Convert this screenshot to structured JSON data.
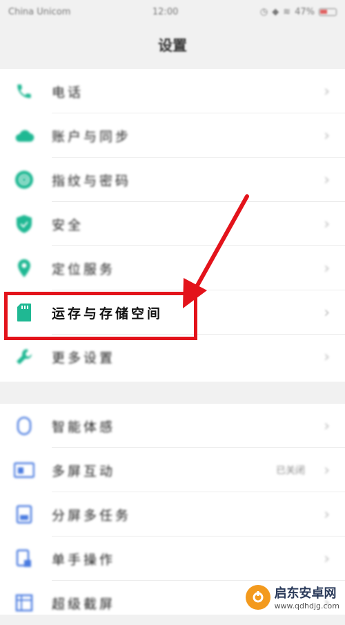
{
  "status_bar": {
    "carrier": "China Unicom",
    "time": "12:00",
    "battery": "47%"
  },
  "header": {
    "title": "设置"
  },
  "group1": [
    {
      "label": "电话",
      "icon": "phone-icon"
    },
    {
      "label": "账户与同步",
      "icon": "cloud-icon"
    },
    {
      "label": "指纹与密码",
      "icon": "fingerprint-icon"
    },
    {
      "label": "安全",
      "icon": "shield-icon"
    },
    {
      "label": "定位服务",
      "icon": "location-icon"
    },
    {
      "label": "运存与存储空间",
      "icon": "sd-card-icon"
    },
    {
      "label": "更多设置",
      "icon": "wrench-icon"
    }
  ],
  "group2": [
    {
      "label": "智能体感",
      "icon": "motion-icon"
    },
    {
      "label": "多屏互动",
      "icon": "multiscreen-icon",
      "value": "已关闭"
    },
    {
      "label": "分屏多任务",
      "icon": "split-screen-icon"
    },
    {
      "label": "单手操作",
      "icon": "one-hand-icon"
    },
    {
      "label": "超级截屏",
      "icon": "screenshot-icon"
    }
  ],
  "chevron": "›",
  "watermark": {
    "name": "启东安卓网",
    "url": "www.qdhdjg.com"
  },
  "colors": {
    "accent_green": "#1fb893",
    "accent_blue": "#4a7be0",
    "highlight_red": "#e3131b"
  }
}
